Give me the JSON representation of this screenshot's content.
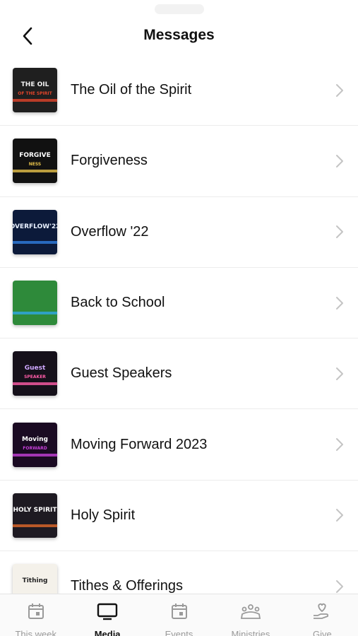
{
  "header": {
    "title": "Messages"
  },
  "messages": [
    {
      "title": "The Oil of the Spirit",
      "thumb": {
        "lines": [
          "THE OIL",
          "OF THE SPIRIT"
        ],
        "bg": "#1f1f1f",
        "fg": "#f0f0f0",
        "accent": "#e0442a"
      }
    },
    {
      "title": "Forgiveness",
      "thumb": {
        "lines": [
          "FORGIVE",
          "NESS"
        ],
        "bg": "#111111",
        "fg": "#ffffff",
        "accent": "#e6c14a"
      }
    },
    {
      "title": "Overflow '22",
      "thumb": {
        "lines": [
          "OVERFLOW'22"
        ],
        "bg": "#0c1a3a",
        "fg": "#e8f0ff",
        "accent": "#2f7de0"
      }
    },
    {
      "title": "Back to School",
      "thumb": {
        "lines": [],
        "bg": "#2e8a3a",
        "fg": "#ffffff",
        "accent": "#2fa6e6"
      }
    },
    {
      "title": "Guest Speakers",
      "thumb": {
        "lines": [
          "Guest",
          "SPEAKER"
        ],
        "bg": "#15101a",
        "fg": "#cfa8ff",
        "accent": "#ff5ca8"
      }
    },
    {
      "title": "Moving Forward 2023",
      "thumb": {
        "lines": [
          "Moving",
          "FORWARD"
        ],
        "bg": "#1a0a22",
        "fg": "#ffffff",
        "accent": "#c640d8"
      }
    },
    {
      "title": "Holy Spirit",
      "thumb": {
        "lines": [
          "HOLY SPIRIT"
        ],
        "bg": "#1e1a22",
        "fg": "#ffffff",
        "accent": "#e0682a"
      }
    },
    {
      "title": "Tithes & Offerings",
      "thumb": {
        "lines": [
          "Tithing"
        ],
        "bg": "#f4f1ea",
        "fg": "#222222",
        "accent": "#8a7a5a"
      }
    }
  ],
  "tabs": [
    {
      "label": "This week",
      "icon": "calendar-icon",
      "active": false
    },
    {
      "label": "Media",
      "icon": "tv-icon",
      "active": true
    },
    {
      "label": "Events",
      "icon": "calendar-icon",
      "active": false
    },
    {
      "label": "Ministries",
      "icon": "people-icon",
      "active": false
    },
    {
      "label": "Give",
      "icon": "heart-hand-icon",
      "active": false
    }
  ],
  "colors": {
    "active": "#111111",
    "inactive": "#9a9a9a",
    "chevron": "#c4c4c4"
  }
}
